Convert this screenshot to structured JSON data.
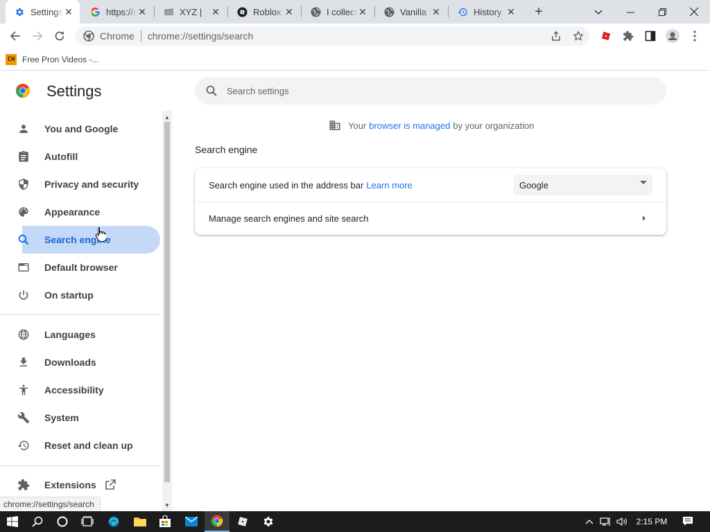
{
  "tabs": [
    {
      "title": "Settings",
      "icon": "gear-icon",
      "active": true
    },
    {
      "title": "https://c",
      "icon": "google-icon"
    },
    {
      "title": "XYZ |",
      "icon": "xyz-icon"
    },
    {
      "title": "Roblox |",
      "icon": "roblox-icon"
    },
    {
      "title": "I collect",
      "icon": "globe-icon"
    },
    {
      "title": "Vanilla L",
      "icon": "globe-icon"
    },
    {
      "title": "History",
      "icon": "history-icon"
    }
  ],
  "omnibox": {
    "chip": "Chrome",
    "url": "chrome://settings/search"
  },
  "bookmarks": [
    {
      "label": "Free Pron Videos -...",
      "favicon_text": "CH"
    }
  ],
  "settings": {
    "title": "Settings",
    "search_placeholder": "Search settings"
  },
  "sidebar": {
    "items": [
      {
        "label": "You and Google",
        "icon": "person-icon"
      },
      {
        "label": "Autofill",
        "icon": "clipboard-icon"
      },
      {
        "label": "Privacy and security",
        "icon": "shield-icon"
      },
      {
        "label": "Appearance",
        "icon": "palette-icon"
      },
      {
        "label": "Search engine",
        "icon": "search-icon",
        "selected": true
      },
      {
        "label": "Default browser",
        "icon": "browser-icon"
      },
      {
        "label": "On startup",
        "icon": "power-icon"
      }
    ],
    "advanced": [
      {
        "label": "Languages",
        "icon": "globe-icon"
      },
      {
        "label": "Downloads",
        "icon": "download-icon"
      },
      {
        "label": "Accessibility",
        "icon": "accessibility-icon"
      },
      {
        "label": "System",
        "icon": "wrench-icon"
      },
      {
        "label": "Reset and clean up",
        "icon": "restore-icon"
      }
    ],
    "extensions": {
      "label": "Extensions",
      "icon": "puzzle-icon"
    }
  },
  "managed": {
    "prefix": "Your",
    "link": "browser is managed",
    "suffix": "by your organization"
  },
  "section": {
    "title": "Search engine",
    "row1_label": "Search engine used in the address bar",
    "row1_link": "Learn more",
    "row1_value": "Google",
    "row2_label": "Manage search engines and site search"
  },
  "status_url": "chrome://settings/search",
  "taskbar": {
    "time": "2:15 PM"
  },
  "colors": {
    "accent": "#1a73e8",
    "selected_bg": "#c4d8f7",
    "taskbar": "#1c1c1c"
  }
}
